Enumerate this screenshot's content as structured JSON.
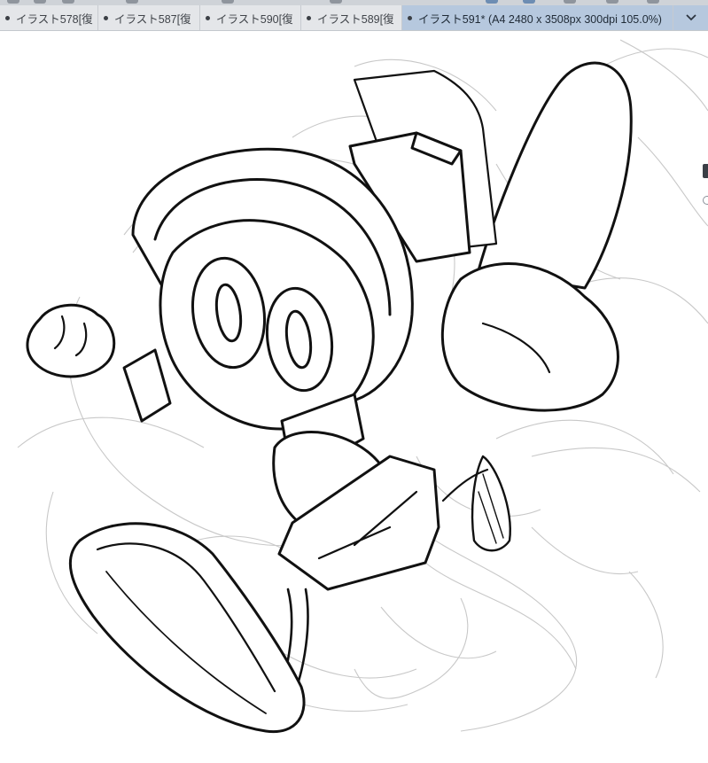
{
  "tabs": [
    {
      "label": "イラスト578[復",
      "active": false
    },
    {
      "label": "イラスト587[復",
      "active": false
    },
    {
      "label": "イラスト590[復",
      "active": false
    },
    {
      "label": "イラスト589[復",
      "active": false
    },
    {
      "label": "イラスト591* (A4 2480 x 3508px 300dpi 105.0%)",
      "active": true
    }
  ],
  "tab_overflow_icon": "chevron-down-icon",
  "colors": {
    "tab_active": "#b6c8de",
    "tab_bar": "#e4e6e9",
    "ink": "#111111",
    "sketch": "#c4c4c4"
  }
}
